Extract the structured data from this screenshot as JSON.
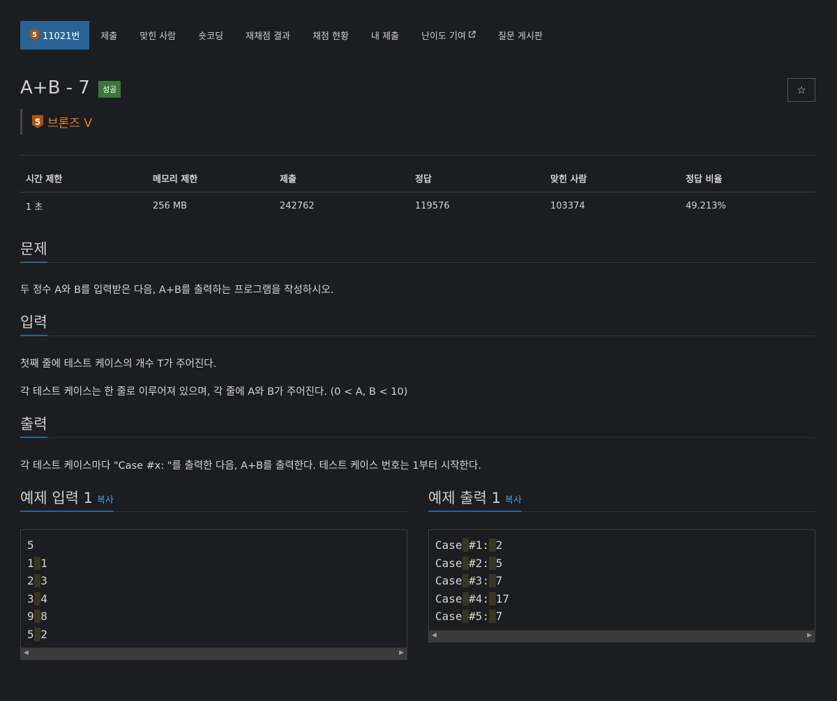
{
  "nav": {
    "problem_tier": "5",
    "problem_number": "11021번",
    "items": [
      "제출",
      "맞힌 사람",
      "숏코딩",
      "재채점 결과",
      "채점 현황",
      "내 제출",
      "난이도 기여",
      "질문 게시판"
    ]
  },
  "title": {
    "text": "A+B - 7",
    "badge": "성공",
    "star_icon": "star-outline-icon"
  },
  "tier": {
    "level": "5",
    "name": "브론즈 V",
    "color": "#e67e22"
  },
  "info": {
    "headers": [
      "시간 제한",
      "메모리 제한",
      "제출",
      "정답",
      "맞힌 사람",
      "정답 비율"
    ],
    "values": [
      "1 초",
      "256 MB",
      "242762",
      "119576",
      "103374",
      "49.213%"
    ]
  },
  "sections": {
    "problem": {
      "title": "문제",
      "body": "두 정수 A와 B를 입력받은 다음, A+B를 출력하는 프로그램을 작성하시오."
    },
    "input": {
      "title": "입력",
      "body1": "첫째 줄에 테스트 케이스의 개수 T가 주어진다.",
      "body2": "각 테스트 케이스는 한 줄로 이루어져 있으며, 각 줄에 A와 B가 주어진다. (0 < A, B < 10)"
    },
    "output": {
      "title": "출력",
      "body": "각 테스트 케이스마다 \"Case #x: \"를 출력한 다음, A+B를 출력한다. 테스트 케이스 번호는 1부터 시작한다."
    }
  },
  "samples": {
    "input": {
      "title": "예제 입력 1",
      "copy": "복사",
      "lines": [
        [
          "5"
        ],
        [
          "1",
          "1"
        ],
        [
          "2",
          "3"
        ],
        [
          "3",
          "4"
        ],
        [
          "9",
          "8"
        ],
        [
          "5",
          "2"
        ]
      ]
    },
    "output": {
      "title": "예제 출력 1",
      "copy": "복사",
      "lines": [
        [
          "Case",
          "#1:",
          "2"
        ],
        [
          "Case",
          "#2:",
          "5"
        ],
        [
          "Case",
          "#3:",
          "7"
        ],
        [
          "Case",
          "#4:",
          "17"
        ],
        [
          "Case",
          "#5:",
          "7"
        ]
      ]
    }
  },
  "colors": {
    "active_tab": "#2a6496",
    "success_badge": "#3c763d",
    "bronze": "#ad5600",
    "link": "#4a9fd8"
  }
}
